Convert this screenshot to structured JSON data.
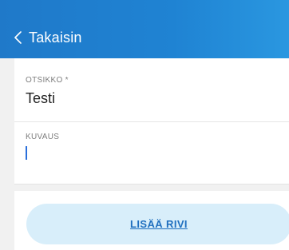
{
  "header": {
    "back_label": "Takaisin",
    "icon": "chevron-left-icon",
    "gradient": [
      "#1f79c9",
      "#2a97e0"
    ]
  },
  "form": {
    "title_label": "OTSIKKO *",
    "title_value": "Testi",
    "description_label": "KUVAUS",
    "description_value": ""
  },
  "actions": {
    "add_row_label": "LISÄÄ RIVI",
    "add_row_bg": "#d8eefa",
    "add_row_text_color": "#1f6fbf"
  }
}
